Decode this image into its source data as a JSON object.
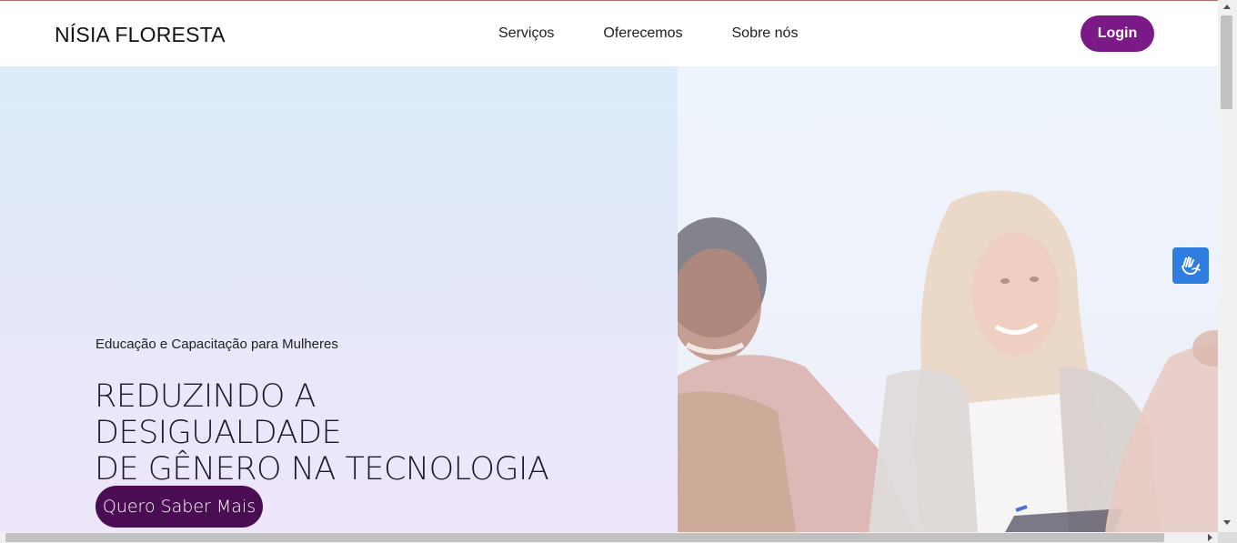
{
  "header": {
    "brand": "NÍSIA FLORESTA",
    "nav": [
      {
        "label": "Serviços"
      },
      {
        "label": "Oferecemos"
      },
      {
        "label": "Sobre nós"
      }
    ],
    "login_label": "Login"
  },
  "hero": {
    "subtitle": "Educação e Capacitação para Mulheres",
    "title_line1": "REDUZINDO A DESIGUALDADE",
    "title_line2": "DE GÊNERO NA TECNOLOGIA",
    "cta_label": "Quero Saber Mais"
  },
  "photo": {
    "alt_subject": "women-smiling-photo"
  },
  "accessibility": {
    "icon": "sign-language-icon"
  },
  "colors": {
    "login_button": "#7b1a86",
    "cta_button": "#4a0c52",
    "accessibility_button": "#2f7de0"
  }
}
